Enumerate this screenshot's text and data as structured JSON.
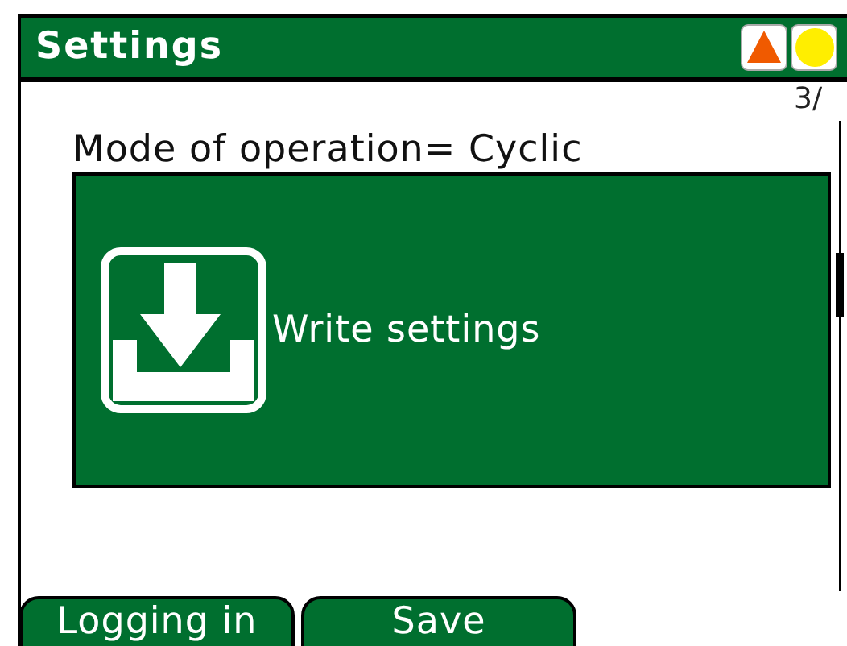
{
  "window": {
    "title": "Settings"
  },
  "page_indicator": "3/",
  "mode_line": "Mode of operation= Cyclic",
  "action_panel": {
    "label": "Write settings"
  },
  "softkeys": [
    {
      "label": "Logging in"
    },
    {
      "label": "Save"
    }
  ]
}
